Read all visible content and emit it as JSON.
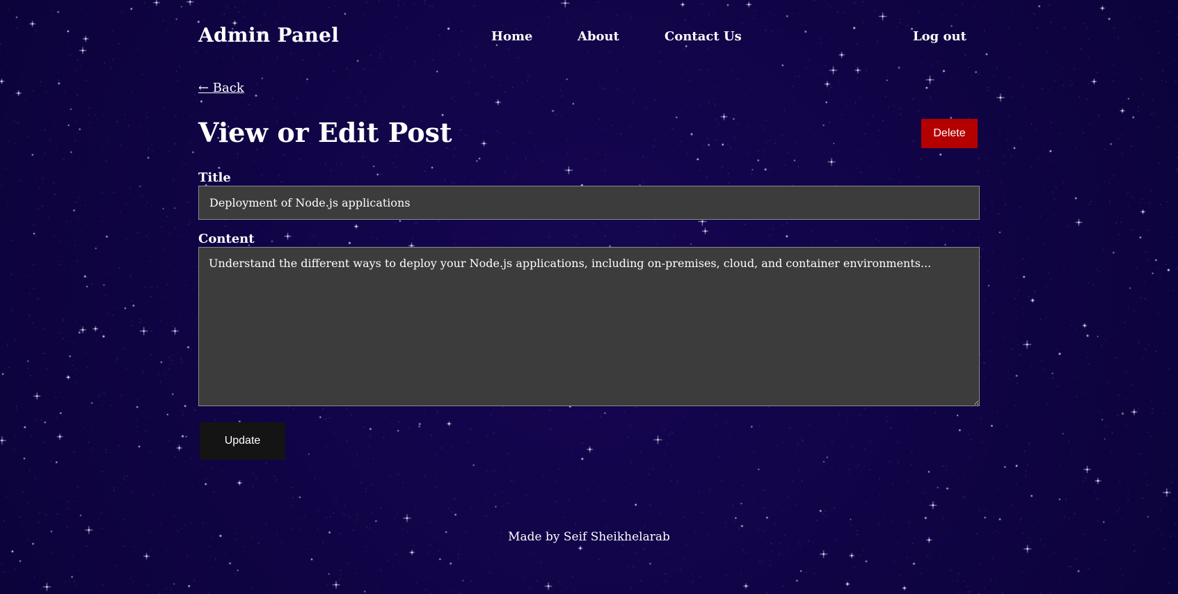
{
  "header": {
    "brand": "Admin Panel",
    "nav": {
      "home": "Home",
      "about": "About",
      "contact": "Contact Us"
    },
    "logout": "Log out"
  },
  "back_link": "← Back",
  "page_title": "View or Edit Post",
  "delete_label": "Delete",
  "form": {
    "title_label": "Title",
    "title_value": "Deployment of Node.js applications",
    "content_label": "Content",
    "content_value": "Understand the different ways to deploy your Node.js applications, including on-premises, cloud, and container environments...",
    "update_label": "Update"
  },
  "footer": "Made by Seif Sheikhelarab",
  "colors": {
    "background": "#0f0440",
    "delete_button": "#b50000",
    "field_background": "#3c3c3c",
    "update_button": "#141414",
    "text": "#ffffff"
  }
}
